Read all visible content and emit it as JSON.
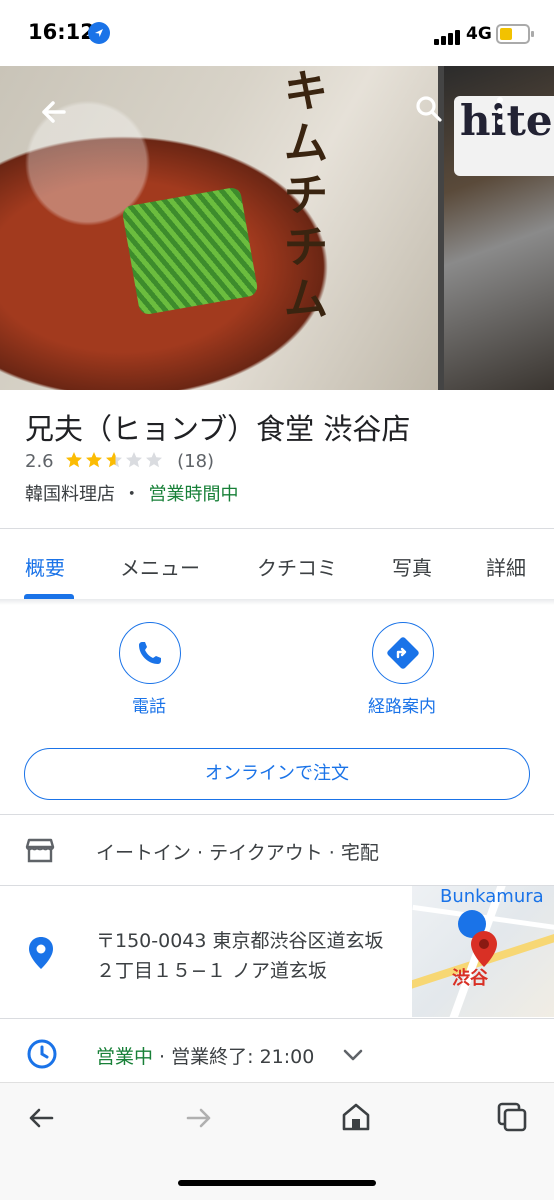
{
  "status_bar": {
    "time": "16:12",
    "network": "4G"
  },
  "place": {
    "name": "兄夫（ヒョンブ）食堂 渋谷店",
    "rating": "2.6",
    "rating_value": 2.6,
    "review_count": "(18)",
    "category": "韓国料理店",
    "separator": "・",
    "open_status": "営業時間中"
  },
  "tabs": [
    {
      "label": "概要",
      "active": true
    },
    {
      "label": "メニュー"
    },
    {
      "label": "クチコミ"
    },
    {
      "label": "写真"
    },
    {
      "label": "詳細"
    }
  ],
  "actions": {
    "call_label": "電話",
    "directions_label": "経路案内"
  },
  "order_button": "オンラインで注文",
  "service_options": "イートイン · テイクアウト · 宅配",
  "address": {
    "line1": "〒150-0043 東京都渋谷区道玄坂",
    "line2": "２丁目１５−１ ノア道玄坂"
  },
  "hours": {
    "status": "営業中",
    "dot": " · ",
    "closing": "営業終了: 21:00"
  },
  "map": {
    "landmark": "Bunkamura",
    "station": "渋谷"
  },
  "photo": {
    "menu_text": "キムチチム",
    "bottle_text": "hite"
  },
  "colors": {
    "accent": "#1a73e8",
    "open_green": "#188038",
    "star": "#fbbc04"
  },
  "icons": [
    "back-arrow-icon",
    "search-icon",
    "more-vert-icon",
    "phone-icon",
    "directions-icon",
    "storefront-icon",
    "location-pin-icon",
    "clock-icon",
    "chevron-down-icon",
    "browser-back-icon",
    "browser-forward-icon",
    "home-icon",
    "tabs-icon"
  ]
}
